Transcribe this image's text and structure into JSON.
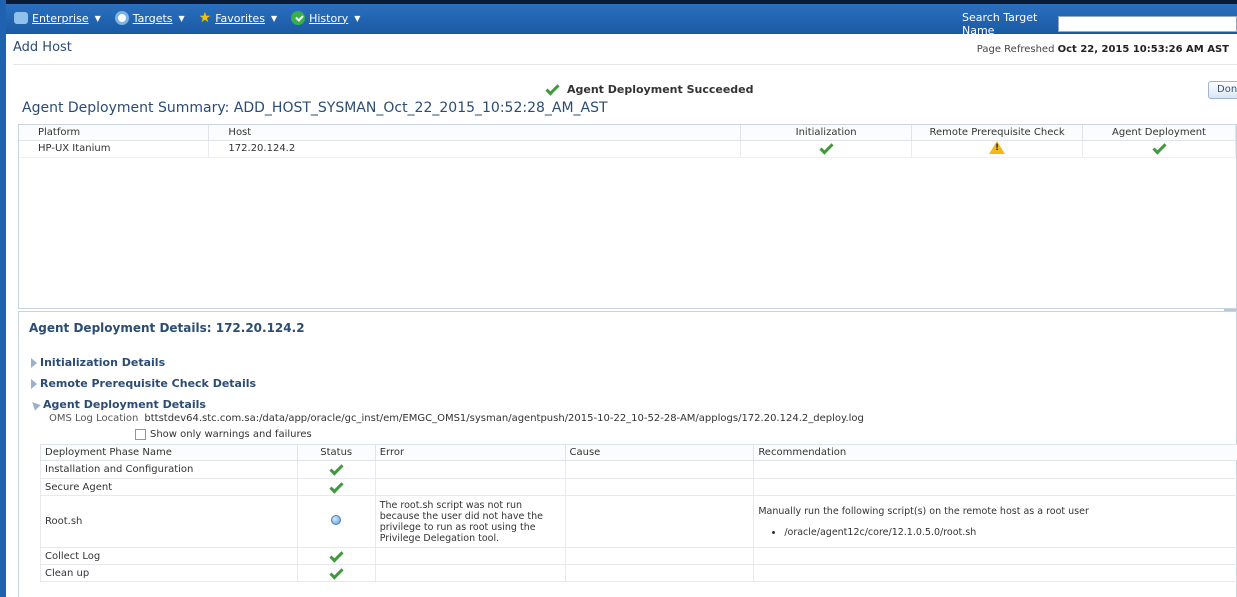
{
  "nav": {
    "items": [
      {
        "label": "Enterprise",
        "icon": "enterprise-icon"
      },
      {
        "label": "Targets",
        "icon": "targets-icon"
      },
      {
        "label": "Favorites",
        "icon": "star-icon"
      },
      {
        "label": "History",
        "icon": "history-icon"
      }
    ],
    "search_label": "Search Target Name"
  },
  "page": {
    "title": "Add Host",
    "refreshed_label": "Page Refreshed",
    "refreshed_value": "Oct 22, 2015 10:53:26 AM AST",
    "status_message": "Agent Deployment Succeeded",
    "done_label": "Done",
    "summary_title": "Agent Deployment Summary: ADD_HOST_SYSMAN_Oct_22_2015_10:52:28_AM_AST"
  },
  "summary_table": {
    "headers": [
      "Platform",
      "Host",
      "Initialization",
      "Remote Prerequisite Check",
      "Agent Deployment"
    ],
    "rows": [
      {
        "platform": "HP-UX Itanium",
        "host": "172.20.124.2",
        "initialization": "success",
        "prereq": "warning",
        "deployment": "success"
      }
    ]
  },
  "details": {
    "title": "Agent Deployment Details: 172.20.124.2",
    "sections": [
      {
        "label": "Initialization Details",
        "expanded": false
      },
      {
        "label": "Remote Prerequisite Check Details",
        "expanded": false
      },
      {
        "label": "Agent Deployment Details",
        "expanded": true
      }
    ],
    "oms_log_label": "OMS Log Location",
    "oms_log_value": "bttstdev64.stc.com.sa:/data/app/oracle/gc_inst/em/EMGC_OMS1/sysman/agentpush/2015-10-22_10-52-28-AM/applogs/172.20.124.2_deploy.log",
    "checkbox_label": "Show only warnings and failures",
    "checkbox_checked": false,
    "table": {
      "headers": [
        "Deployment Phase Name",
        "Status",
        "Error",
        "Cause",
        "Recommendation"
      ],
      "rows": [
        {
          "phase": "Installation and Configuration",
          "status": "success",
          "error": "",
          "cause": "",
          "recommendation": ""
        },
        {
          "phase": "Secure Agent",
          "status": "success",
          "error": "",
          "cause": "",
          "recommendation": ""
        },
        {
          "phase": "Root.sh",
          "status": "info",
          "error": "The root.sh script was not run because the user did not have the privilege to run as root using the Privilege Delegation tool.",
          "cause": "",
          "recommendation": "Manually run the following script(s) on the remote host as a root user",
          "recommendation_item": "/oracle/agent12c/core/12.1.0.5.0/root.sh"
        },
        {
          "phase": "Collect Log",
          "status": "success",
          "error": "",
          "cause": "",
          "recommendation": ""
        },
        {
          "phase": "Clean up",
          "status": "success",
          "error": "",
          "cause": "",
          "recommendation": ""
        }
      ]
    }
  },
  "colors": {
    "header_blue": "#1b5aa3",
    "title_blue": "#2b4c74",
    "success_green": "#3d9b3a",
    "warning_yellow": "#f2b81c"
  }
}
